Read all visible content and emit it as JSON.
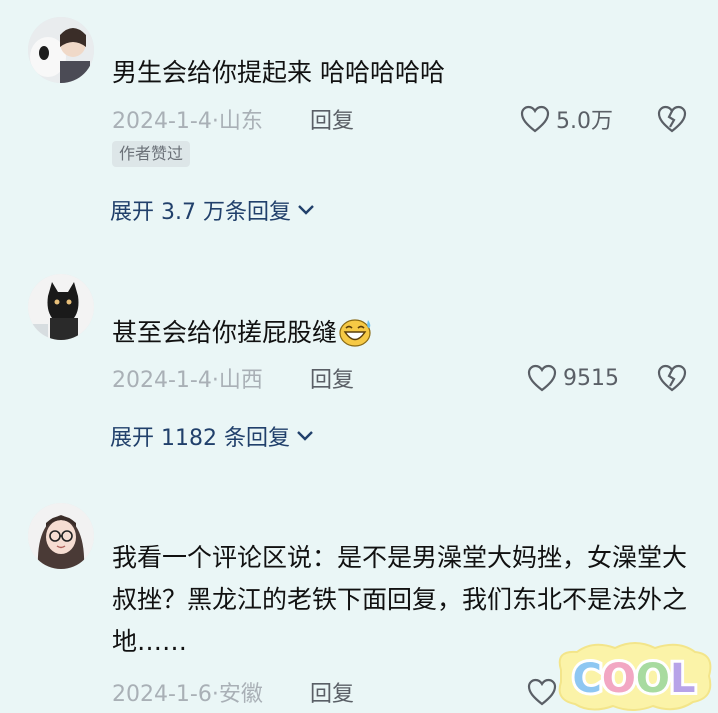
{
  "comments": [
    {
      "text": "男生会给你提起来 哈哈哈哈哈",
      "date": "2024-1-4·山东",
      "reply_label": "回复",
      "likes": "5.0万",
      "badge": "作者赞过",
      "expand_label": "展开 3.7 万条回复"
    },
    {
      "text": "甚至会给你搓屁股缝",
      "date": "2024-1-4·山西",
      "reply_label": "回复",
      "likes": "9515",
      "expand_label": "展开 1182 条回复"
    },
    {
      "text": "我看一个评论区说：是不是男澡堂大妈挫，女澡堂大叔挫？黑龙江的老铁下面回复，我们东北不是法外之地……",
      "date": "2024-1-6·安徽",
      "reply_label": "回复"
    }
  ],
  "sticker": {
    "text": "COOL"
  },
  "colors": {
    "background": "#eaf6f6",
    "meta_gray": "#a9b0b6",
    "expand_blue": "#21406b"
  }
}
